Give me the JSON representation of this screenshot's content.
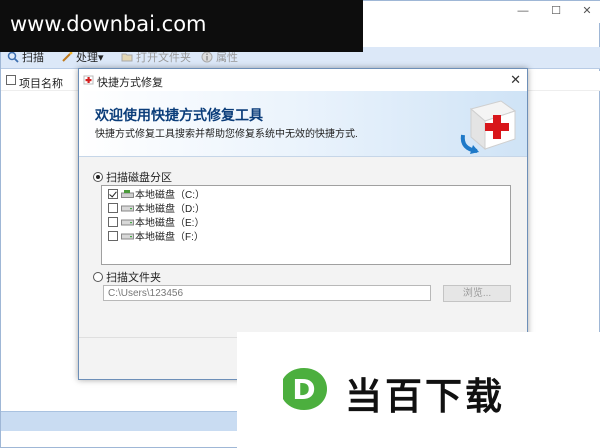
{
  "watermark": {
    "site": "www.downbai.com"
  },
  "window": {
    "minimize": "—",
    "maximize": "☐",
    "close": "✕"
  },
  "toolbar": {
    "scan": "扫描",
    "process": "处理",
    "process_arrow": "▾",
    "open_folder": "打开文件夹",
    "properties": "属性"
  },
  "list": {
    "column_name": "项目名称"
  },
  "dialog": {
    "title": "快捷方式修复",
    "close": "✕",
    "heading": "欢迎使用快捷方式修复工具",
    "subtitle": "快捷方式修复工具搜索并帮助您修复系统中无效的快捷方式.",
    "scan_partition_label": "扫描磁盘分区",
    "drives": [
      {
        "label": "本地磁盘（C:）",
        "checked": true
      },
      {
        "label": "本地磁盘（D:）",
        "checked": false
      },
      {
        "label": "本地磁盘（E:）",
        "checked": false
      },
      {
        "label": "本地磁盘（F:）",
        "checked": false
      }
    ],
    "scan_folder_label": "扫描文件夹",
    "folder_path": "C:\\Users\\123456",
    "browse": "浏览..."
  },
  "brand": {
    "logo_letter": "D",
    "name": "当百下载",
    "logo_color": "#4caf3e"
  }
}
